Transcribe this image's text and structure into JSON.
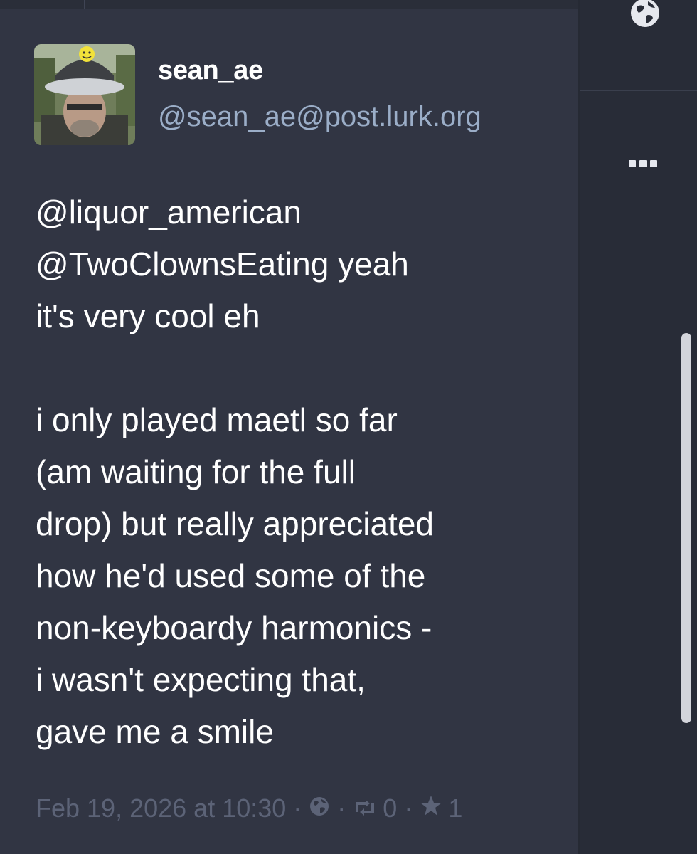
{
  "account": {
    "display_name": "sean_ae",
    "handle": "@sean_ae@post.lurk.org",
    "avatar_icon": "avatar-photo"
  },
  "status": {
    "mentions": [
      "@liquor_american",
      "@TwoClownsEating"
    ],
    "line1_mention": "@liquor_american",
    "line2_mention": "@TwoClownsEating",
    "line2_rest": " yeah",
    "line3": "it's very cool eh",
    "para2": [
      "i only played maetl so far",
      "(am waiting for the full",
      "drop) but really appreciated",
      "how he'd used some of the",
      "non-keyboardy harmonics -",
      "i wasn't expecting that,",
      "gave me a smile"
    ]
  },
  "meta": {
    "timestamp": "Feb 19, 2026 at 10:30",
    "separator": "·",
    "visibility_icon": "globe-icon",
    "boost_icon": "boost-icon",
    "boost_count": "0",
    "favourite_icon": "star-icon",
    "favourite_count": "1"
  },
  "rail": {
    "top_icon": "globe-icon",
    "more_icon": "more-horizontal-icon"
  },
  "colors": {
    "background": "#282c37",
    "card": "#313543",
    "text": "#ffffff",
    "handle": "#9baec8",
    "muted": "#5c6377"
  }
}
